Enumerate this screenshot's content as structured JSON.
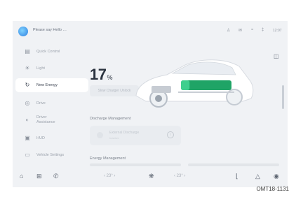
{
  "header": {
    "voice_prompt": "Please say Hello …",
    "status_icons": [
      "person-icon",
      "message-icon",
      "wifi-icon",
      "bluetooth-icon"
    ],
    "time": "12:07"
  },
  "sidebar": {
    "items": [
      {
        "label": "Quick Control",
        "icon": "quick-control-icon",
        "glyph": "▤",
        "active": false
      },
      {
        "label": "Light",
        "icon": "light-icon",
        "glyph": "☀",
        "active": false
      },
      {
        "label": "New Energy",
        "icon": "new-energy-icon",
        "glyph": "↻",
        "active": true
      },
      {
        "label": "Drive",
        "icon": "drive-icon",
        "glyph": "◎",
        "active": false
      },
      {
        "label": "Driver Assistance",
        "label_line1": "Driver",
        "label_line2": "Assistance",
        "icon": "driver-assistance-icon",
        "glyph": "◐",
        "active": false
      },
      {
        "label": "HUD",
        "icon": "hud-icon",
        "glyph": "▣",
        "active": false
      },
      {
        "label": "Vehicle Settings",
        "icon": "vehicle-settings-icon",
        "glyph": "▭",
        "active": false
      }
    ]
  },
  "main": {
    "battery_percent": "17",
    "battery_unit": "%",
    "battery_level": 0.17,
    "slow_charger_label": "Slow Charger Unlock",
    "discharge_title": "Discharge Management",
    "external_discharge_label": "External Discharge",
    "external_discharge_sub": "Inactive",
    "energy_title": "Energy Management"
  },
  "dock": {
    "temp_left": "‹  23°  ›",
    "temp_right": "‹  23°  ›"
  },
  "caption": "OMT18-1131",
  "colors": {
    "background": "#f0f2f5",
    "active_item": "#ffffff",
    "battery_green": "#3fcf8e",
    "accent_blue": "#2f7fe0"
  }
}
